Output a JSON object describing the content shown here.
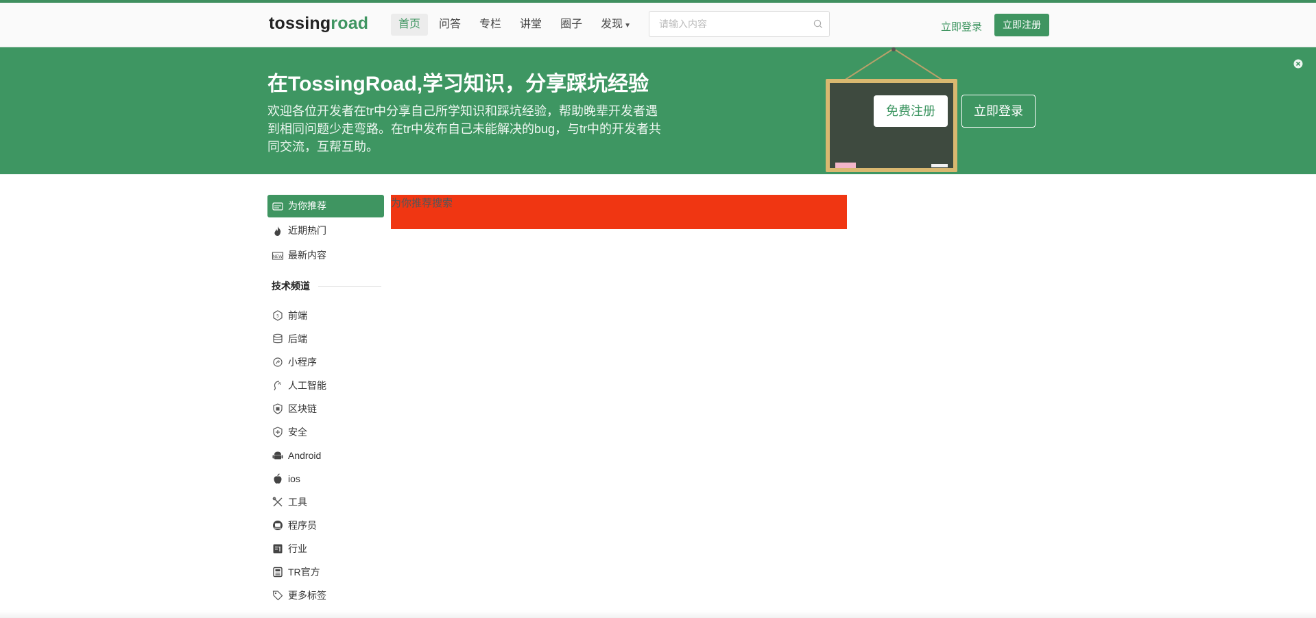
{
  "header": {
    "logo_part1": "tossing",
    "logo_part2": "road",
    "nav": [
      {
        "label": "首页",
        "active": true
      },
      {
        "label": "问答"
      },
      {
        "label": "专栏"
      },
      {
        "label": "讲堂"
      },
      {
        "label": "圈子"
      },
      {
        "label": "发现",
        "has_dropdown": true
      }
    ],
    "search_placeholder": "请输入内容",
    "login_label": "立即登录",
    "register_label": "立即注册"
  },
  "banner": {
    "title": "在TossingRoad,学习知识，分享踩坑经验",
    "description": "欢迎各位开发者在tr中分享自己所学知识和踩坑经验，帮助晚辈开发者遇到相同问题少走弯路。在tr中发布自己未能解决的bug，与tr中的开发者共同交流，互帮互助。",
    "free_register_label": "免费注册",
    "login_label": "立即登录"
  },
  "sidebar": {
    "primary": [
      {
        "label": "为你推荐",
        "icon": "recommend-icon",
        "active": true
      },
      {
        "label": "近期热门",
        "icon": "fire-icon"
      },
      {
        "label": "最新内容",
        "icon": "new-icon"
      }
    ],
    "section_title": "技术频道",
    "channels": [
      {
        "label": "前端",
        "icon": "frontend-icon"
      },
      {
        "label": "后端",
        "icon": "database-icon"
      },
      {
        "label": "小程序",
        "icon": "miniprogram-icon"
      },
      {
        "label": "人工智能",
        "icon": "ai-icon"
      },
      {
        "label": "区块链",
        "icon": "blockchain-icon"
      },
      {
        "label": "安全",
        "icon": "shield-icon"
      },
      {
        "label": "Android",
        "icon": "android-icon"
      },
      {
        "label": "ios",
        "icon": "apple-icon"
      },
      {
        "label": "工具",
        "icon": "tools-icon"
      },
      {
        "label": "程序员",
        "icon": "programmer-icon"
      },
      {
        "label": "行业",
        "icon": "industry-icon"
      },
      {
        "label": "TR官方",
        "icon": "official-icon"
      },
      {
        "label": "更多标签",
        "icon": "tag-icon"
      }
    ]
  },
  "main": {
    "promo_text": "为你推荐搜索"
  },
  "colors": {
    "brand": "#3f9561",
    "banner_bg": "#3e9662",
    "promo_bg": "#f03612"
  }
}
